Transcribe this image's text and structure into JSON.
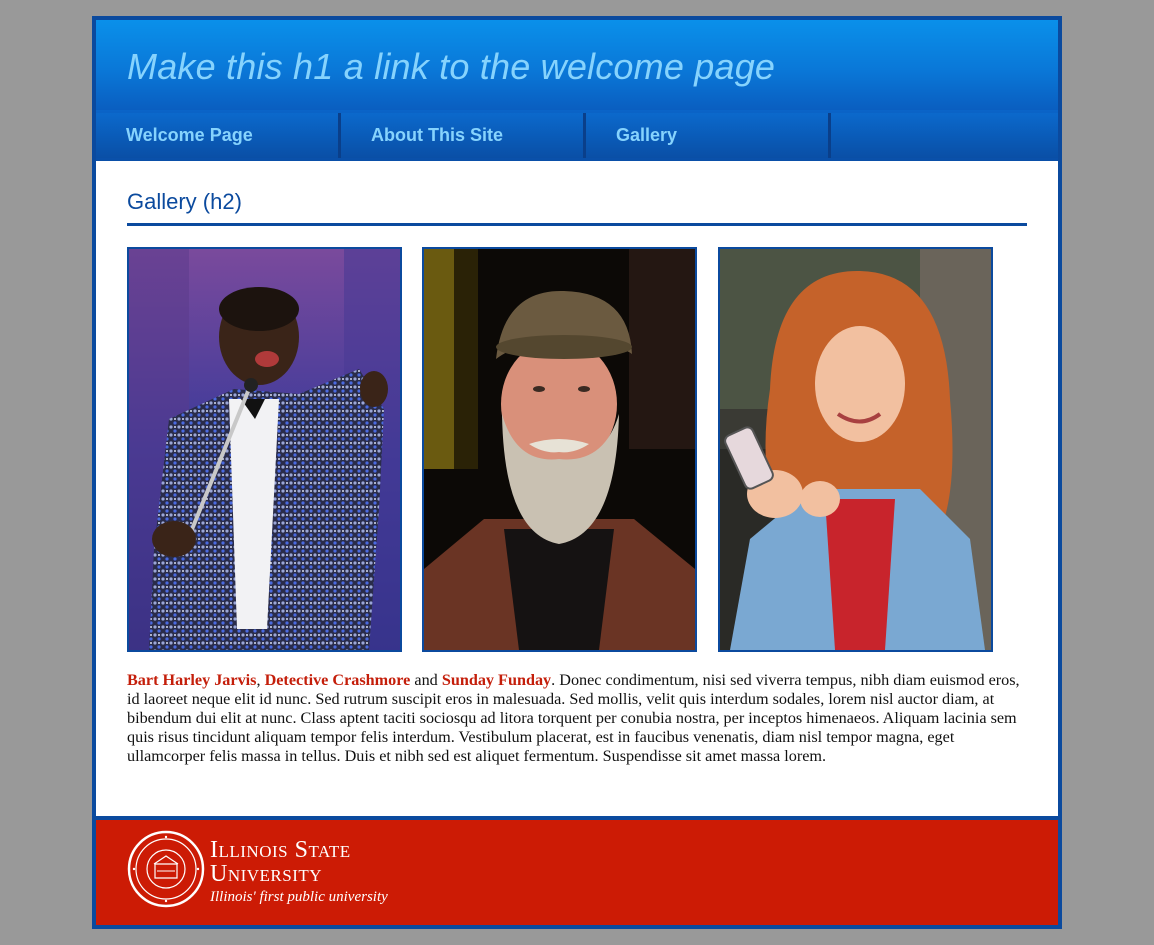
{
  "header": {
    "title": "Make this h1 a link to the welcome page"
  },
  "nav": {
    "items": [
      {
        "label": "Welcome Page"
      },
      {
        "label": "About This Site"
      },
      {
        "label": "Gallery"
      },
      {
        "label": ""
      }
    ]
  },
  "main": {
    "heading": "Gallery (h2)",
    "gallery": [
      {
        "alt": "Bart Harley Jarvis"
      },
      {
        "alt": "Detective Crashmore"
      },
      {
        "alt": "Sunday Funday"
      }
    ],
    "caption": {
      "link1": "Bart Harley Jarvis",
      "sep1": ", ",
      "link2": "Detective Crashmore",
      "sep2": " and ",
      "link3": "Sunday Funday",
      "body": ". Donec condimentum, nisi sed viverra tempus, nibh diam euismod eros, id laoreet neque elit id nunc. Sed rutrum suscipit eros in malesuada. Sed mollis, velit quis interdum sodales, lorem nisl auctor diam, at bibendum dui elit at nunc. Class aptent taciti sociosqu ad litora torquent per conubia nostra, per inceptos himenaeos. Aliquam lacinia sem quis risus tincidunt aliquam tempor felis interdum. Vestibulum placerat, est in faucibus venenatis, diam nisl tempor magna, eget ullamcorper felis massa in tellus. Duis et nibh sed est aliquet fermentum. Suspendisse sit amet massa lorem."
    }
  },
  "footer": {
    "name_line1": "Illinois State",
    "name_line2": "University",
    "tagline": "Illinois' first public university",
    "seal_text": "ILLINOIS STATE UNIVERSITY 1857"
  },
  "colors": {
    "brand_blue": "#0b4a9e",
    "header_text": "#86d3fd",
    "link_red": "#c41e0a",
    "footer_red": "#cc1b05"
  }
}
